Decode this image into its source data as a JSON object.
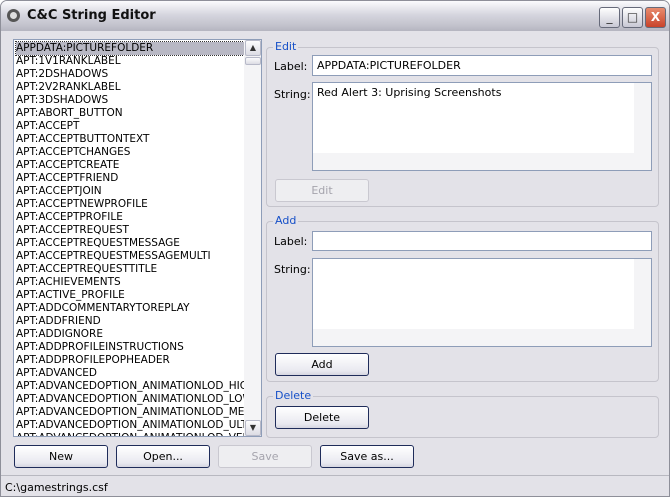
{
  "window": {
    "title": "C&C String Editor",
    "minimize": "_",
    "maximize": "□",
    "close": "X"
  },
  "list": {
    "selected_index": 0,
    "items": [
      "APPDATA:PICTUREFOLDER",
      "APT:1V1RANKLABEL",
      "APT:2DSHADOWS",
      "APT:2V2RANKLABEL",
      "APT:3DSHADOWS",
      "APT:ABORT_BUTTON",
      "APT:ACCEPT",
      "APT:ACCEPTBUTTONTEXT",
      "APT:ACCEPTCHANGES",
      "APT:ACCEPTCREATE",
      "APT:ACCEPTFRIEND",
      "APT:ACCEPTJOIN",
      "APT:ACCEPTNEWPROFILE",
      "APT:ACCEPTPROFILE",
      "APT:ACCEPTREQUEST",
      "APT:ACCEPTREQUESTMESSAGE",
      "APT:ACCEPTREQUESTMESSAGEMULTI",
      "APT:ACCEPTREQUESTTITLE",
      "APT:ACHIEVEMENTS",
      "APT:ACTIVE_PROFILE",
      "APT:ADDCOMMENTARYTOREPLAY",
      "APT:ADDFRIEND",
      "APT:ADDIGNORE",
      "APT:ADDPROFILEINSTRUCTIONS",
      "APT:ADDPROFILEPOPHEADER",
      "APT:ADVANCED",
      "APT:ADVANCEDOPTION_ANIMATIONLOD_HIGH",
      "APT:ADVANCEDOPTION_ANIMATIONLOD_LOW",
      "APT:ADVANCEDOPTION_ANIMATIONLOD_MED",
      "APT:ADVANCEDOPTION_ANIMATIONLOD_ULTRA",
      "APT:ADVANCEDOPTION_ANIMATIONLOD_VERY"
    ]
  },
  "edit": {
    "group": "Edit",
    "label_caption": "Label:",
    "label_value": "APPDATA:PICTUREFOLDER",
    "string_caption": "String:",
    "string_value": "Red Alert 3: Uprising Screenshots",
    "button": "Edit"
  },
  "add": {
    "group": "Add",
    "label_caption": "Label:",
    "label_value": "",
    "string_caption": "String:",
    "string_value": "",
    "button": "Add"
  },
  "delete": {
    "group": "Delete",
    "button": "Delete"
  },
  "buttons": {
    "new": "New",
    "open": "Open...",
    "save": "Save",
    "save_as": "Save as..."
  },
  "status": "C:\\gamestrings.csf"
}
